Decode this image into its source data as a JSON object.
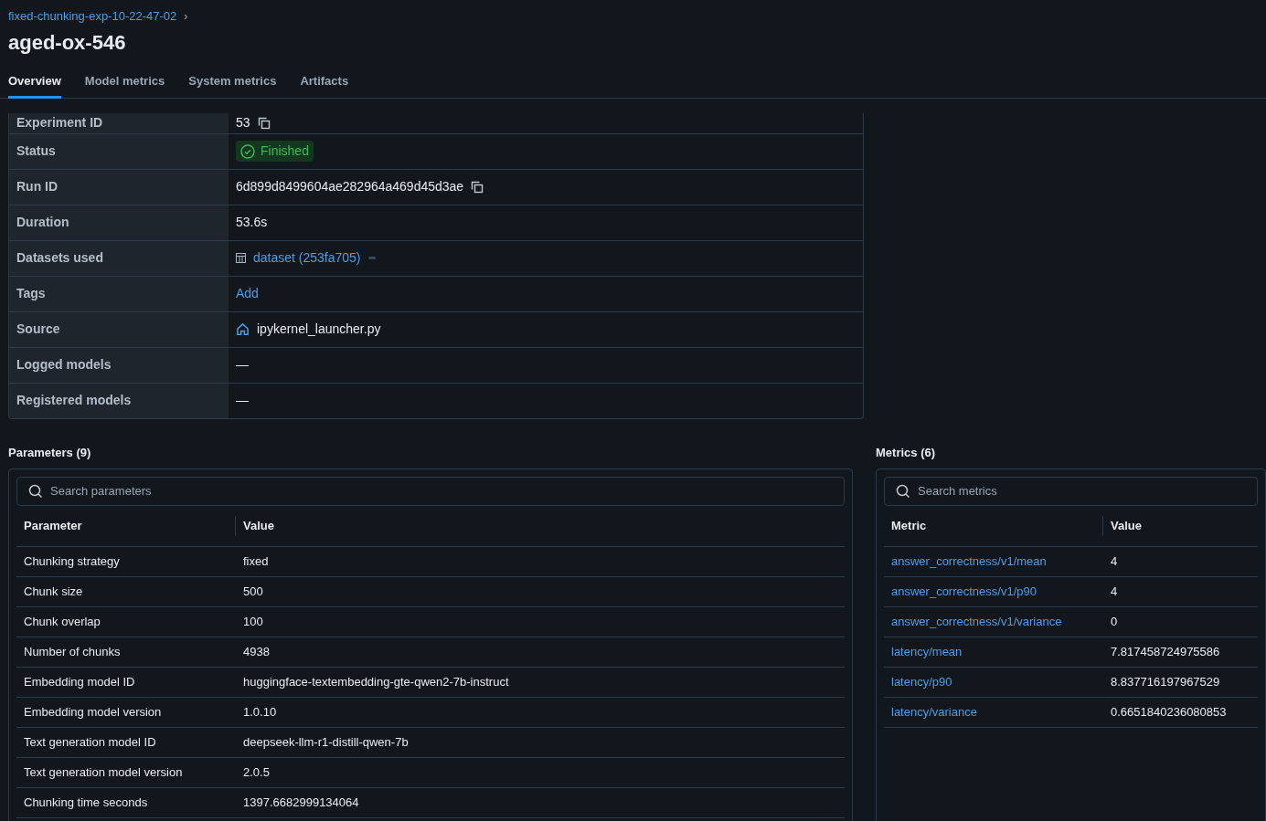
{
  "breadcrumb": {
    "label": "fixed-chunking-exp-10-22-47-02",
    "separator": "›"
  },
  "title": "aged-ox-546",
  "tabs": [
    {
      "label": "Overview",
      "selected": true
    },
    {
      "label": "Model metrics",
      "selected": false
    },
    {
      "label": "System metrics",
      "selected": false
    },
    {
      "label": "Artifacts",
      "selected": false
    }
  ],
  "details": [
    {
      "label": "Experiment ID",
      "kind": "copy",
      "value": "53"
    },
    {
      "label": "Status",
      "kind": "status",
      "value": "Finished"
    },
    {
      "label": "Run ID",
      "kind": "copy",
      "value": "6d899d8499604ae282964a469d45d3ae"
    },
    {
      "label": "Duration",
      "kind": "text",
      "value": "53.6s"
    },
    {
      "label": "Datasets used",
      "kind": "dataset",
      "value": "dataset (253fa705)"
    },
    {
      "label": "Tags",
      "kind": "link",
      "value": "Add"
    },
    {
      "label": "Source",
      "kind": "source",
      "value": "ipykernel_launcher.py"
    },
    {
      "label": "Logged models",
      "kind": "text",
      "value": "—"
    },
    {
      "label": "Registered models",
      "kind": "text",
      "value": "—"
    }
  ],
  "parameters": {
    "title": "Parameters (9)",
    "search": {
      "placeholder": "Search parameters"
    },
    "columns": [
      "Parameter",
      "Value"
    ],
    "rows": [
      [
        "Chunking strategy",
        "fixed"
      ],
      [
        "Chunk size",
        "500"
      ],
      [
        "Chunk overlap",
        "100"
      ],
      [
        "Number of chunks",
        "4938"
      ],
      [
        "Embedding model ID",
        "huggingface-textembedding-gte-qwen2-7b-instruct"
      ],
      [
        "Embedding model version",
        "1.0.10"
      ],
      [
        "Text generation model ID",
        "deepseek-llm-r1-distill-qwen-7b"
      ],
      [
        "Text generation model version",
        "2.0.5"
      ],
      [
        "Chunking time seconds",
        "1397.6682999134064"
      ]
    ]
  },
  "metrics": {
    "title": "Metrics (6)",
    "search": {
      "placeholder": "Search metrics"
    },
    "columns": [
      "Metric",
      "Value"
    ],
    "rows": [
      [
        "answer_correctness/v1/mean",
        "4"
      ],
      [
        "answer_correctness/v1/p90",
        "4"
      ],
      [
        "answer_correctness/v1/variance",
        "0"
      ],
      [
        "latency/mean",
        "7.817458724975586"
      ],
      [
        "latency/p90",
        "8.837716197967529"
      ],
      [
        "latency/variance",
        "0.6651840236080853"
      ]
    ]
  }
}
